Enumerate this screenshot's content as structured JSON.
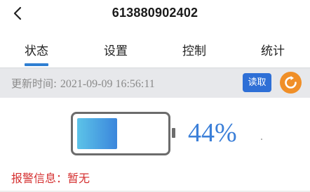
{
  "header": {
    "title": "613880902402"
  },
  "tabs": [
    {
      "label": "状态",
      "active": true
    },
    {
      "label": "设置",
      "active": false
    },
    {
      "label": "控制",
      "active": false
    },
    {
      "label": "统计",
      "active": false
    }
  ],
  "update_bar": {
    "label": "更新时间: ",
    "time": "2021-09-09 16:56:11",
    "read_button": "读取",
    "refresh_icon": "refresh-icon"
  },
  "battery": {
    "percent_text": "44%",
    "level": 0.44
  },
  "alarm": {
    "text": "报警信息：暂无"
  },
  "colors": {
    "accent": "#2f7fd2",
    "read_button": "#2e6fd6",
    "refresh_button": "#f08f28",
    "alarm": "#d53131",
    "battery_fill_start": "#5cc3e8",
    "battery_fill_end": "#3b86dc"
  }
}
